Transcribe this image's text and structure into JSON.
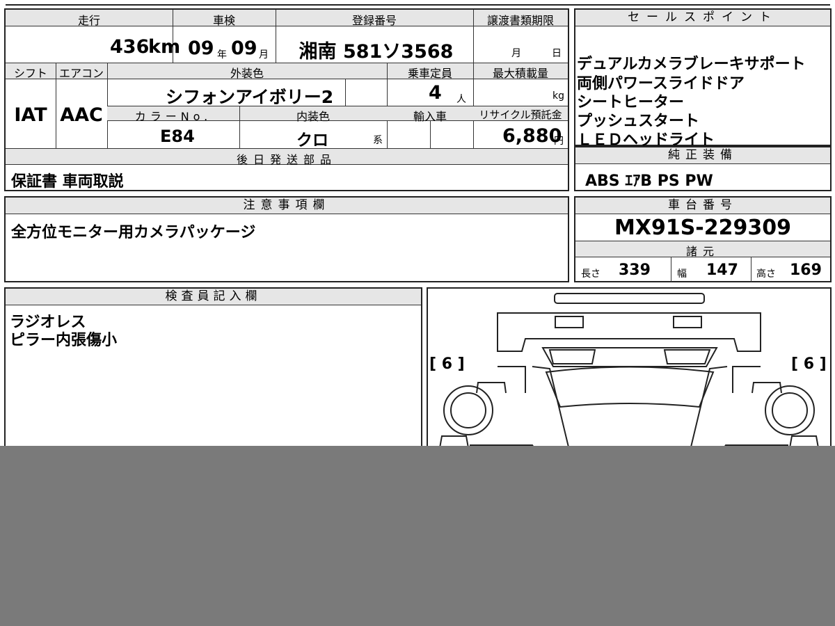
{
  "top": {
    "mileage_label": "走行",
    "mileage_value": "436",
    "mileage_unit": "km",
    "inspection_label": "車検",
    "inspection_year": "09",
    "inspection_year_unit": "年",
    "inspection_month": "09",
    "inspection_month_unit": "月",
    "registration_label": "登録番号",
    "registration_value": "湘南 581ソ3568",
    "transfer_label": "譲渡書類期限",
    "transfer_month_unit": "月",
    "transfer_day_unit": "日"
  },
  "row2": {
    "shift_label": "シフト",
    "aircon_label": "エアコン",
    "exterior_label": "外装色",
    "capacity_label": "乗車定員",
    "maxload_label": "最大積載量",
    "exterior_value": "シフォンアイボリー2",
    "capacity_value": "4",
    "capacity_unit": "人",
    "maxload_unit": "kg",
    "shift_value": "IAT",
    "aircon_value": "AAC",
    "color_no_label": "カラーNo.",
    "interior_label": "内装色",
    "import_label": "輸入車",
    "recycle_label": "リサイクル預託金",
    "color_no_value": "E84",
    "interior_value": "クロ",
    "interior_suffix": "系",
    "recycle_value": "6,880",
    "recycle_unit": "円"
  },
  "later_parts": {
    "label": "後日発送部品",
    "value": "保証書 車両取説"
  },
  "notes": {
    "label": "注意事項欄",
    "value": "全方位モニター用カメラパッケージ"
  },
  "sales_points": {
    "label": "セールスポイント",
    "items": [
      "デュアルカメラブレーキサポート",
      "両側パワースライドドア",
      "シートヒーター",
      "プッシュスタート",
      "ＬＥＤヘッドライト"
    ]
  },
  "genuine": {
    "label": "純正装備",
    "value": "ABS ｴｱB PS PW"
  },
  "chassis": {
    "label": "車台番号",
    "value": "MX91S-229309"
  },
  "specs": {
    "label": "諸元",
    "length_label": "長さ",
    "length": "339",
    "width_label": "幅",
    "width": "147",
    "height_label": "高さ",
    "height": "169"
  },
  "inspector": {
    "label": "検査員記入欄",
    "lines": [
      "ラジオレス",
      "ピラー内張傷小"
    ]
  },
  "diagram": {
    "left_tire": "[ 6 ]",
    "right_tire": "[ 6 ]"
  }
}
